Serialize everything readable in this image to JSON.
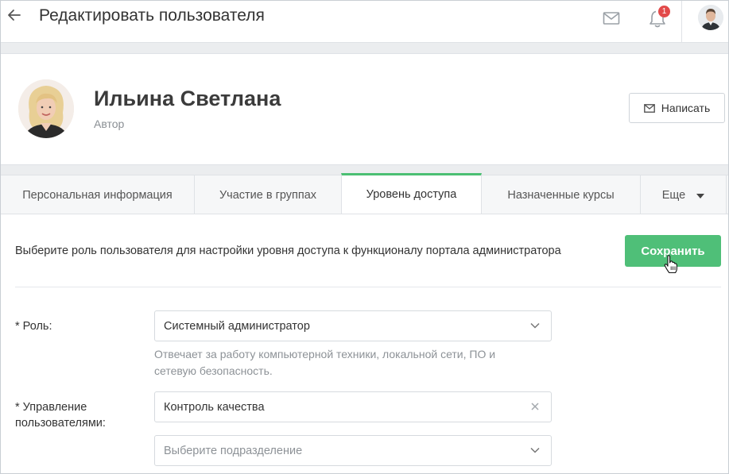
{
  "header": {
    "title": "Редактировать пользователя",
    "back_icon": "arrow-left-icon",
    "notifications_count": "1"
  },
  "profile": {
    "name": "Ильина Светлана",
    "role": "Автор",
    "write_button": "Написать"
  },
  "tabs": [
    {
      "label": "Персональная информация"
    },
    {
      "label": "Участие в группах"
    },
    {
      "label": "Уровень доступа"
    },
    {
      "label": "Назначенные курсы"
    },
    {
      "label": "Еще"
    }
  ],
  "active_tab": "Уровень доступа",
  "content": {
    "hint": "Выберите роль пользователя для настройки уровня доступа к функционалу портала администратора",
    "save_button": "Сохранить",
    "role_label": "* Роль:",
    "role_value": "Системный администратор",
    "role_description": "Отвечает за работу компьютерной техники, локальной сети, ПО и сетевую безопасность.",
    "users_mgmt_label_line1": "* Управление",
    "users_mgmt_label_line2": "пользователями:",
    "users_mgmt_value": "Контроль качества",
    "department_placeholder": "Выберите подразделение"
  },
  "colors": {
    "accent": "#4fbf78",
    "badge": "#e24a4a",
    "active_tab_border": "#4bbf73"
  }
}
